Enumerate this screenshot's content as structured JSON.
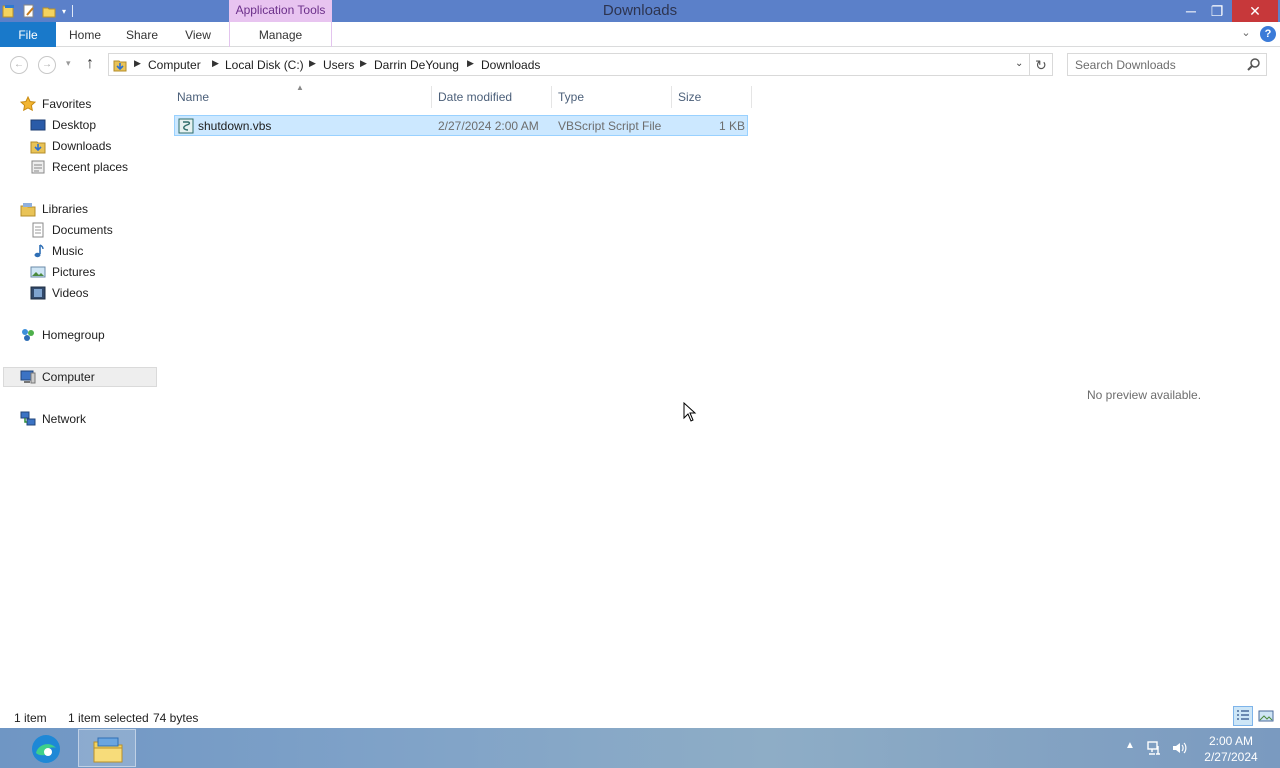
{
  "window": {
    "title": "Downloads",
    "contextual_tab_group": "Application Tools",
    "controls": {
      "minimize": "─",
      "maximize": "❐",
      "close": "✕"
    }
  },
  "ribbon": {
    "tabs": [
      "File",
      "Home",
      "Share",
      "View",
      "Manage"
    ]
  },
  "address": {
    "breadcrumb": [
      "Computer",
      "Local Disk (C:)",
      "Users",
      "Darrin DeYoung",
      "Downloads"
    ],
    "refresh": "↻"
  },
  "search": {
    "placeholder": "Search Downloads"
  },
  "navigation": {
    "favorites": {
      "label": "Favorites",
      "items": [
        "Desktop",
        "Downloads",
        "Recent places"
      ]
    },
    "libraries": {
      "label": "Libraries",
      "items": [
        "Documents",
        "Music",
        "Pictures",
        "Videos"
      ]
    },
    "homegroup": "Homegroup",
    "computer": "Computer",
    "network": "Network"
  },
  "columns": [
    "Name",
    "Date modified",
    "Type",
    "Size"
  ],
  "files": [
    {
      "name": "shutdown.vbs",
      "date_modified": "2/27/2024 2:00 AM",
      "type": "VBScript Script File",
      "size": "1 KB",
      "selected": true
    }
  ],
  "preview": {
    "message": "No preview available."
  },
  "status": {
    "item_count": "1 item",
    "selection": "1 item selected",
    "selection_size": "74 bytes"
  },
  "taskbar": {
    "apps": [
      {
        "name": "Microsoft Edge",
        "icon": "edge-icon"
      },
      {
        "name": "File Explorer",
        "icon": "folder-icon",
        "active": true
      }
    ],
    "clock": {
      "time": "2:00 AM",
      "date": "2/27/2024"
    }
  },
  "colors": {
    "titlebar": "#5b80c9",
    "file_tab": "#1979ca",
    "selection": "#cce8ff",
    "selection_border": "#99d1ff",
    "close_button": "#c7383a"
  }
}
